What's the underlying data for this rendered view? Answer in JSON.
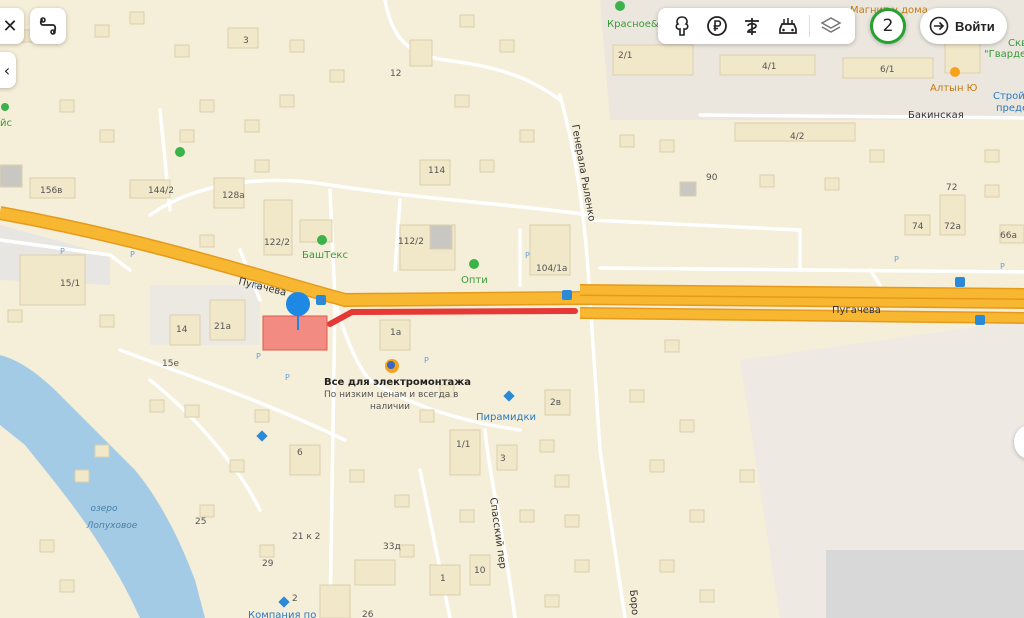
{
  "controls": {
    "close_icon": "close-icon",
    "route_icon": "route-icon",
    "collapse_icon": "chevron-left-icon",
    "layer_tools": [
      "parks-icon",
      "ruble-icon",
      "pharmacy-icon",
      "cars-icon",
      "layers-icon"
    ],
    "traffic_level": "2",
    "login_label": "Войти",
    "traffic_color": "#27a22f"
  },
  "streets": {
    "main": "Пугачева",
    "main_east": "Пугачева",
    "ryhlenko": "Генерала Рыленко",
    "spassky": "Спасский пер",
    "bakinskaya": "Бакинская",
    "boro": "Боро"
  },
  "places": {
    "selected": "Все для электромонтажа",
    "selected_desc_1": "По низким ценам и всегда в",
    "selected_desc_2": "наличии",
    "bashteks": "БашТекс",
    "opti": "Опти",
    "piramidki": "Пирамидки",
    "altyn": "Алтын Ю",
    "krasnoe": "Красное&",
    "magnit": "Магнит у дома",
    "stroy": "Строй",
    "stroy2": "преде",
    "gvard_1": "Скв",
    "gvard_2": "\"Гварде",
    "company": "Компания по",
    "left_cut": "йс"
  },
  "water": {
    "lake_1": "озеро",
    "lake_2": "Лопуховое"
  },
  "house_numbers": [
    {
      "label": "3"
    },
    {
      "label": "12"
    },
    {
      "label": "2/1"
    },
    {
      "label": "4/1"
    },
    {
      "label": "6/1"
    },
    {
      "label": "4/2"
    },
    {
      "label": "156в"
    },
    {
      "label": "144/2"
    },
    {
      "label": "128а"
    },
    {
      "label": "114"
    },
    {
      "label": "90"
    },
    {
      "label": "72"
    },
    {
      "label": "74"
    },
    {
      "label": "72а"
    },
    {
      "label": "66а"
    },
    {
      "label": "122/2"
    },
    {
      "label": "112/2"
    },
    {
      "label": "104/1а"
    },
    {
      "label": "15/1"
    },
    {
      "label": "14"
    },
    {
      "label": "21а"
    },
    {
      "label": "1а"
    },
    {
      "label": "15е"
    },
    {
      "label": "2в"
    },
    {
      "label": "1/1"
    },
    {
      "label": "3"
    },
    {
      "label": "6"
    },
    {
      "label": "25"
    },
    {
      "label": "21 к 2"
    },
    {
      "label": "33д"
    },
    {
      "label": "29"
    },
    {
      "label": "1"
    },
    {
      "label": "10"
    },
    {
      "label": "2"
    },
    {
      "label": "26"
    }
  ],
  "route": {
    "color": "#e53935",
    "description": "traffic jam segment"
  },
  "colors": {
    "land": "#f5eed8",
    "major_road": "#f7b731",
    "road_edge": "#e69a1c",
    "minor_road": "#ffffff",
    "water": "#a4cbe5",
    "building": "#f1e7c9",
    "building_edge": "#dcd0ad",
    "industrial": "#e9e5dd",
    "pin": "#1e88e5",
    "selected_building": "#f28b82"
  }
}
